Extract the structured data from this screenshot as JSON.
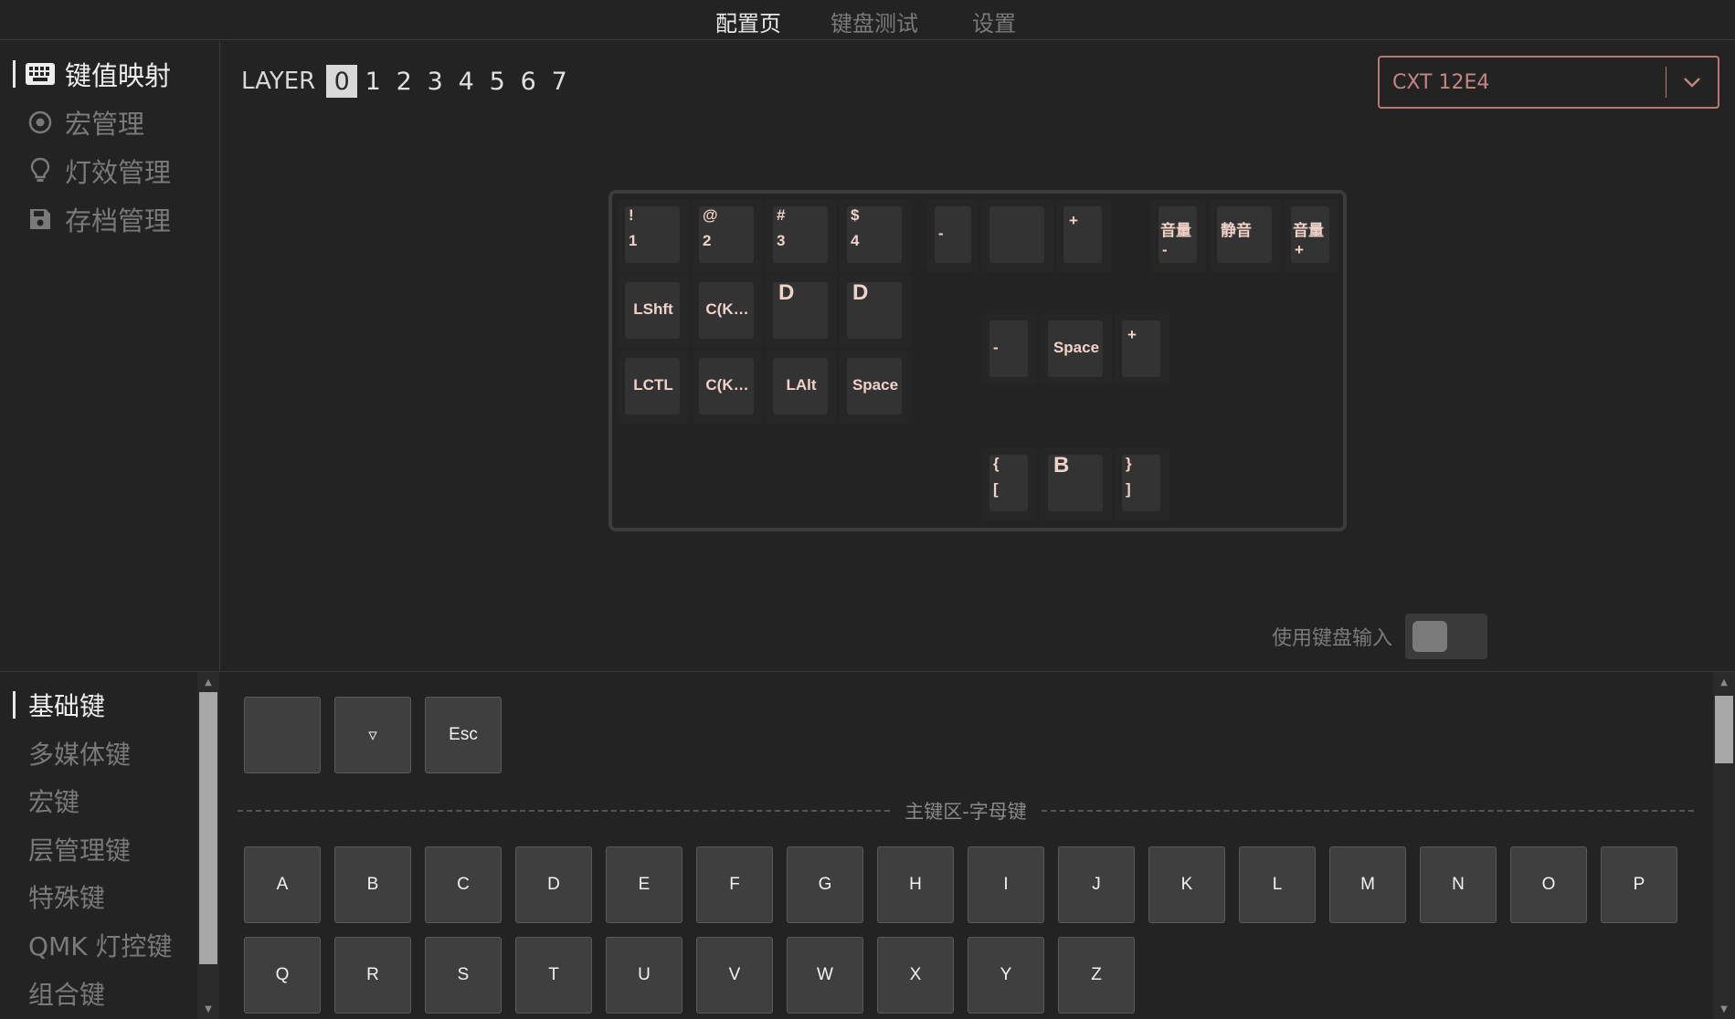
{
  "top_tabs": [
    {
      "label": "配置页",
      "active": true
    },
    {
      "label": "键盘测试",
      "active": false
    },
    {
      "label": "设置",
      "active": false
    }
  ],
  "sidebar": {
    "items": [
      {
        "label": "键值映射",
        "icon": "keyboard-icon",
        "active": true
      },
      {
        "label": "宏管理",
        "icon": "record-icon",
        "active": false
      },
      {
        "label": "灯效管理",
        "icon": "lightbulb-icon",
        "active": false
      },
      {
        "label": "存档管理",
        "icon": "save-icon",
        "active": false
      }
    ]
  },
  "layer": {
    "label": "LAYER",
    "numbers": [
      "0",
      "1",
      "2",
      "3",
      "4",
      "5",
      "6",
      "7"
    ],
    "active": "0"
  },
  "device": {
    "value": "CXT 12E4",
    "icon": "chevron-down-icon"
  },
  "keyboard": {
    "keys": {
      "k_1": {
        "top": "!",
        "bottom": "1"
      },
      "k_2": {
        "top": "@",
        "bottom": "2"
      },
      "k_3": {
        "top": "#",
        "bottom": "3"
      },
      "k_4": {
        "top": "$",
        "bottom": "4"
      },
      "k_lshft": "LShft",
      "k_ck1": "C(K…",
      "k_d1": "D",
      "k_d2": "D",
      "k_lctl": "LCTL",
      "k_ck2": "C(K…",
      "k_lalt": "LAlt",
      "k_space1": "Space",
      "k_minus1": "-",
      "k_blank": "",
      "k_plus1": "+",
      "k_volm": {
        "top": "音量",
        "bottom": "-"
      },
      "k_mute": "静音",
      "k_volp": {
        "top": "音量",
        "bottom": "+"
      },
      "k_minus2": "-",
      "k_space2": "Space",
      "k_plus2": "+",
      "k_brace_l": {
        "top": "{",
        "bottom": "["
      },
      "k_b": "B",
      "k_brace_r": {
        "top": "}",
        "bottom": "]"
      }
    }
  },
  "keyboard_input_toggle": {
    "label": "使用键盘输入",
    "on": false
  },
  "categories": [
    "基础键",
    "多媒体键",
    "宏键",
    "层管理键",
    "特殊键",
    "QMK 灯控键",
    "组合键"
  ],
  "palette": {
    "special": [
      "",
      "▿",
      "Esc"
    ],
    "section_title": "主键区-字母键",
    "letters": [
      "A",
      "B",
      "C",
      "D",
      "E",
      "F",
      "G",
      "H",
      "I",
      "J",
      "K",
      "L",
      "M",
      "N",
      "O",
      "P",
      "Q",
      "R",
      "S",
      "T",
      "U",
      "V",
      "W",
      "X",
      "Y",
      "Z"
    ]
  }
}
